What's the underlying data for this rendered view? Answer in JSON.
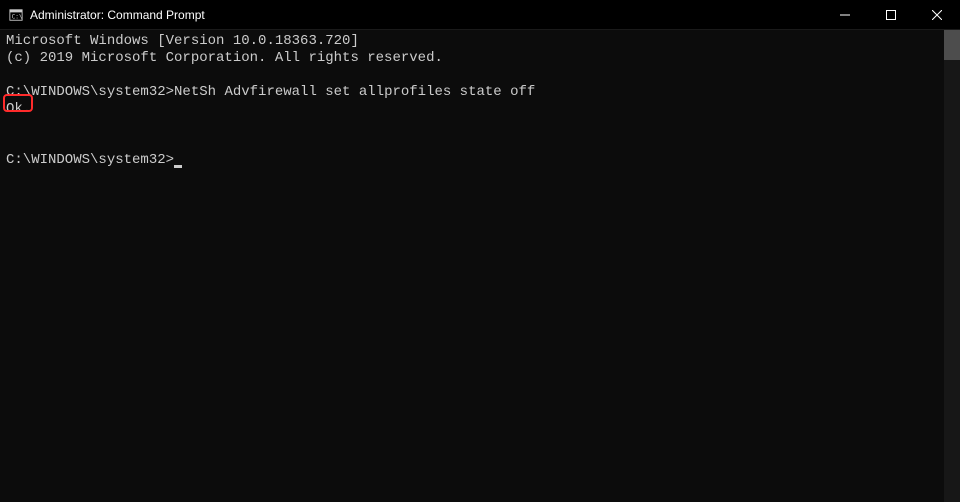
{
  "titlebar": {
    "title": "Administrator: Command Prompt"
  },
  "terminal": {
    "line1": "Microsoft Windows [Version 10.0.18363.720]",
    "line2": "(c) 2019 Microsoft Corporation. All rights reserved.",
    "prompt1": "C:\\WINDOWS\\system32>",
    "command1": "NetSh Advfirewall set allprofiles state off",
    "result1": "Ok.",
    "prompt2": "C:\\WINDOWS\\system32>"
  }
}
